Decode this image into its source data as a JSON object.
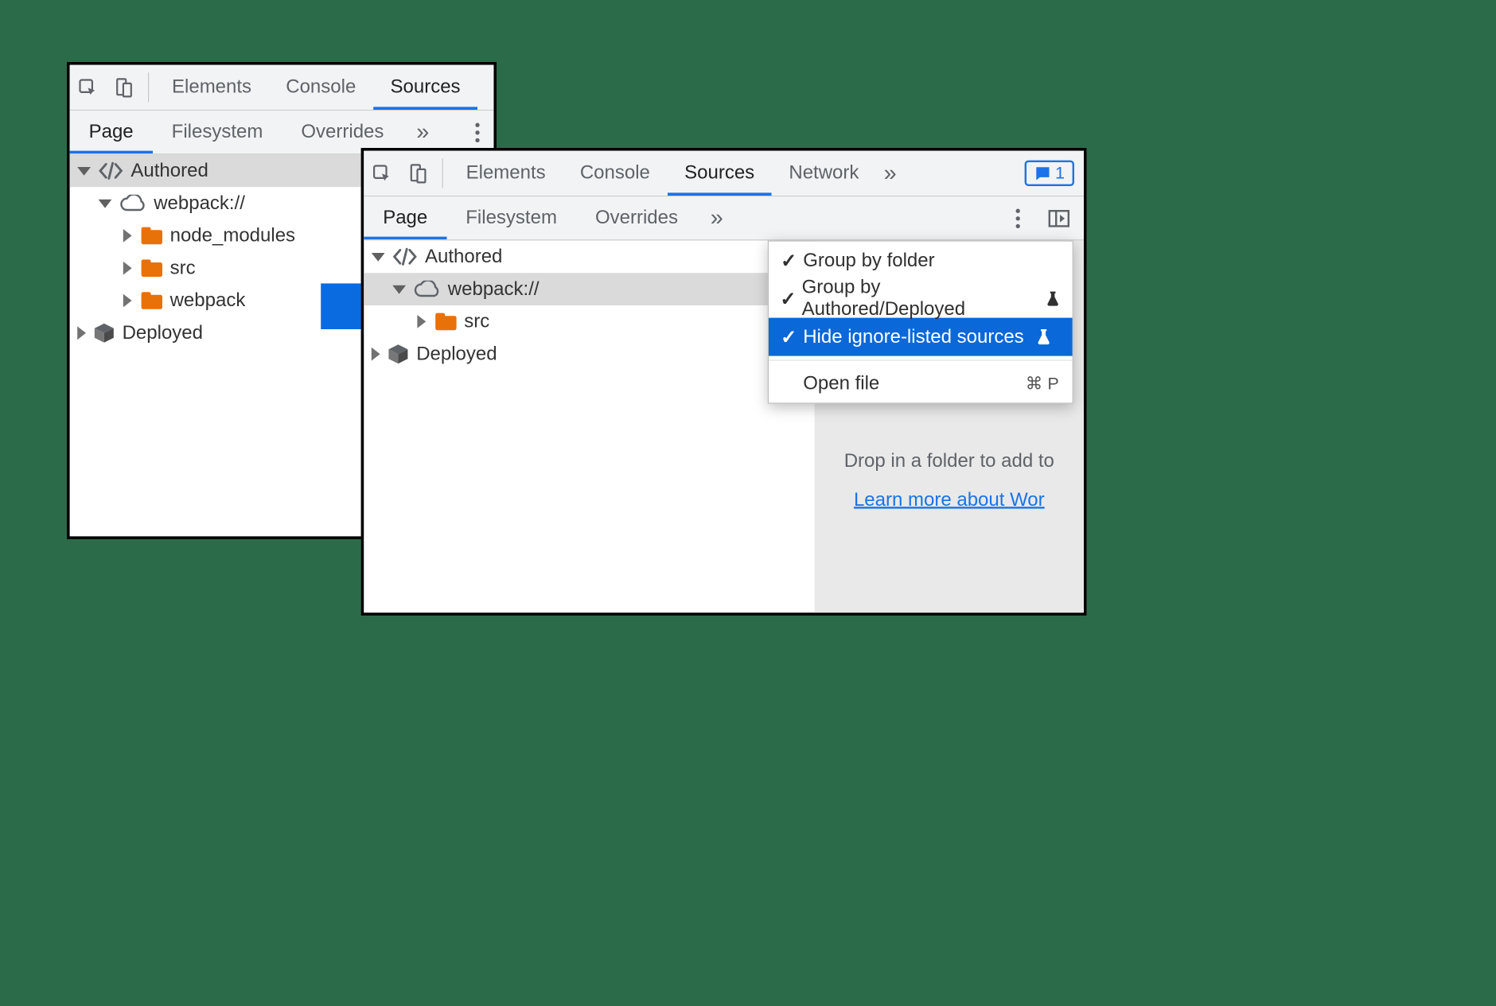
{
  "leftPanel": {
    "topTabs": {
      "elements": "Elements",
      "console": "Console",
      "sources": "Sources"
    },
    "subTabs": {
      "page": "Page",
      "filesystem": "Filesystem",
      "overrides": "Overrides"
    },
    "tree": {
      "authored": "Authored",
      "webpack": "webpack://",
      "node_modules": "node_modules",
      "src": "src",
      "webpackFolder": "webpack",
      "deployed": "Deployed"
    }
  },
  "rightPanel": {
    "topTabs": {
      "elements": "Elements",
      "console": "Console",
      "sources": "Sources",
      "network": "Network"
    },
    "badgeCount": "1",
    "subTabs": {
      "page": "Page",
      "filesystem": "Filesystem",
      "overrides": "Overrides"
    },
    "tree": {
      "authored": "Authored",
      "webpack": "webpack://",
      "src": "src",
      "deployed": "Deployed"
    },
    "menu": {
      "groupFolder": "Group by folder",
      "groupAuthored": "Group by Authored/Deployed",
      "hideIgnore": "Hide ignore-listed sources",
      "openFile": "Open file",
      "openFileShortcut": "⌘ P"
    },
    "hint": {
      "drop": "Drop in a folder to add to",
      "learn": "Learn more about Wor"
    }
  }
}
